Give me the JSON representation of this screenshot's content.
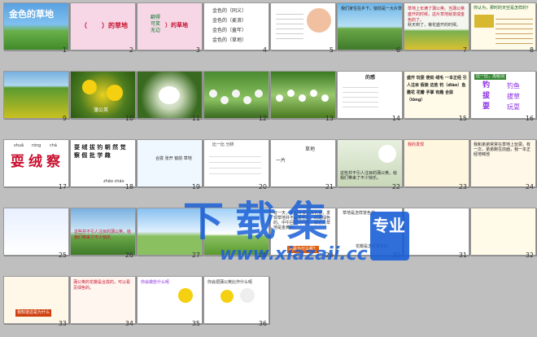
{
  "title_slide": {
    "title": "金色的草地"
  },
  "slide2": {
    "blank_left": "（",
    "blank_right": "）的草地"
  },
  "slide3": {
    "words": [
      "翻得",
      "可笑",
      "无边"
    ],
    "suffix": "）的草地"
  },
  "slide4": {
    "lines": [
      "金色的（同义）",
      "金色的（麦浪）",
      "金色的（童年）",
      "金色的（草地）"
    ]
  },
  "slide6": {
    "text": "我们家住在乡下，窗前是一大片草地"
  },
  "slide7": {
    "text": "草地上长满了蒲公英。当蒲公英盛开的时候，这片草地就变成金色的了。",
    "text2": "秋天到了，菊花盛开的时候。"
  },
  "slide8": {
    "q": "你认为，那时的天空是怎样的？"
  },
  "slide10": {
    "label": "蒲公英"
  },
  "slide14": {
    "header": "的感"
  },
  "slide15": {
    "text": "盛开 玩耍 使劲 绒毛 一本正经 引人注目 假装 这些 钓（diào）鱼 撒花 花瓣 手掌 有趣 合拢（lǒng）"
  },
  "slide16": {
    "header": "比一比，再组词",
    "chars": [
      "钓",
      "钩",
      "拔",
      "披",
      "耍",
      "要"
    ],
    "words": [
      "钓鱼",
      "钩子",
      "拔草",
      "披风",
      "玩耍",
      "要求"
    ]
  },
  "slide17": {
    "chars": [
      "耍",
      "绒",
      "察"
    ],
    "pinyin": [
      "shuǎ",
      "róng",
      "chá"
    ]
  },
  "slide18": {
    "chars": "耍 绒 拔 钓 朝 然 觉 察 假 批 学 趣",
    "bottom": [
      "假",
      "朝",
      "zhāo cháo"
    ]
  },
  "slide19": {
    "text": "合拢 张开 窗前 草地"
  },
  "slide20": {
    "header": "比一比 分析"
  },
  "slide21": {
    "left": "一片",
    "right": "草地"
  },
  "slide22": {
    "text": "蒲公英",
    "sub": "这些并不引人注目的蒲公英，给我们带来了不少快乐。"
  },
  "slide23": {
    "header": "我的发现"
  },
  "slide24": {
    "text": "我和弟弟常常在草地上玩耍。有一次，弟弟跑在前面，我一本正经地喊他"
  },
  "slide26": {
    "text": "这些并不引人注目的蒲公英，给我们带来了不少快乐"
  },
  "slide29": {
    "text": "有一天，我起得很早去钓鱼，发现草地并不是金色的，而是绿色的。中午回家的时候，我看见草地是金黄的。",
    "bottom": "这是为什么呢？"
  },
  "slide30": {
    "header": "草地是怎样变色的",
    "sub": "花瓣是怎样变化的"
  },
  "slide33": {
    "bottom": "我知道这是为什么"
  },
  "slide34": {
    "text": "蒲公英的花瓣是合拢的，可以看见绿色的。"
  },
  "slide35": {
    "text": "你会做些什么呢"
  },
  "slide36": {
    "text": "你会把蒲公英比作什么呢"
  },
  "slide_numbers": [
    "1",
    "2",
    "3",
    "4",
    "5",
    "6",
    "7",
    "8",
    "9",
    "10",
    "11",
    "12",
    "13",
    "14",
    "15",
    "16",
    "17",
    "18",
    "19",
    "20",
    "21",
    "22",
    "23",
    "24",
    "25",
    "26",
    "27",
    "28",
    "29",
    "30",
    "31",
    "32",
    "33",
    "34",
    "35",
    "36"
  ],
  "watermark": {
    "main": "下载集",
    "side": "专业",
    "url": "www.xiazaii.cc"
  },
  "colors": {
    "background": "#bfbfbf",
    "watermark": "#1a5fd6",
    "red_title": "#c8102e",
    "purple": "#8a2be2"
  }
}
